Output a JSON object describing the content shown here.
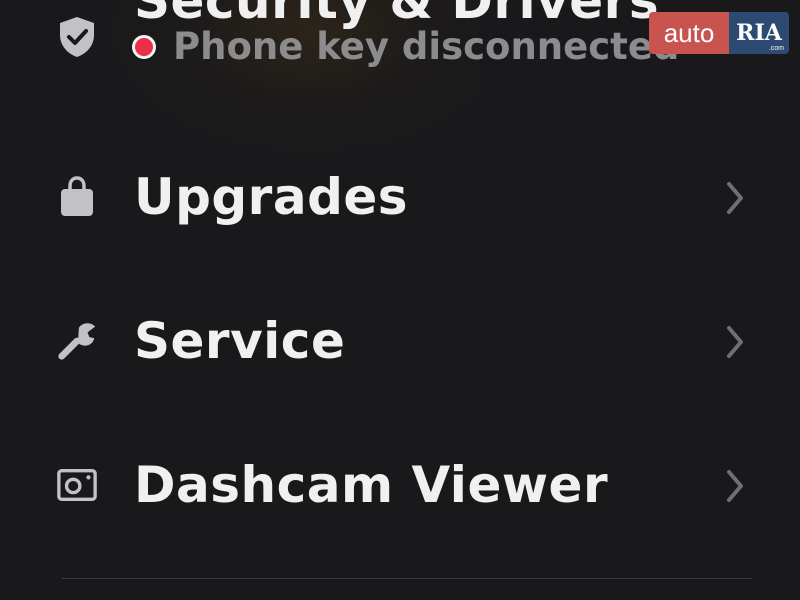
{
  "menu": {
    "items": [
      {
        "label": "Security & Drivers",
        "icon": "shield-check-icon",
        "status": "Phone key disconnected",
        "status_color": "#e8304a"
      },
      {
        "label": "Upgrades",
        "icon": "shopping-bag-icon"
      },
      {
        "label": "Service",
        "icon": "wrench-icon"
      },
      {
        "label": "Dashcam Viewer",
        "icon": "dashcam-icon"
      }
    ]
  },
  "watermark": {
    "left": "auto",
    "right": "RIA",
    "suffix": ".com"
  },
  "colors": {
    "background": "#19191b",
    "text": "#f0f0f0",
    "muted": "#8c8c8f",
    "icon": "#c2c2c6",
    "chevron": "#6f6f73",
    "alert": "#e8304a",
    "watermark_red": "#c9544f",
    "watermark_blue": "#2c4a72"
  }
}
